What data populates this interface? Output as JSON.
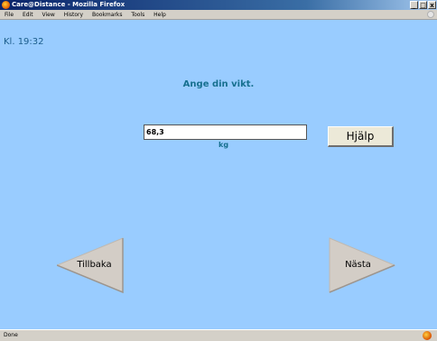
{
  "window": {
    "title": "Care@Distance - Mozilla Firefox",
    "controls": {
      "minimize": "_",
      "maximize": "□",
      "close": "x"
    }
  },
  "menubar": {
    "items": [
      "File",
      "Edit",
      "View",
      "History",
      "Bookmarks",
      "Tools",
      "Help"
    ]
  },
  "page": {
    "time": "Kl. 19:32",
    "prompt": "Ange din vikt.",
    "weight_value": "68,3",
    "unit": "kg",
    "help_label": "Hjälp",
    "back_label": "Tillbaka",
    "next_label": "Nästa",
    "background_color": "#99ccff",
    "accent_color": "#17708f",
    "arrow_color": "#d3cdc6"
  },
  "statusbar": {
    "text": "Done",
    "icon": "firefox-icon"
  }
}
